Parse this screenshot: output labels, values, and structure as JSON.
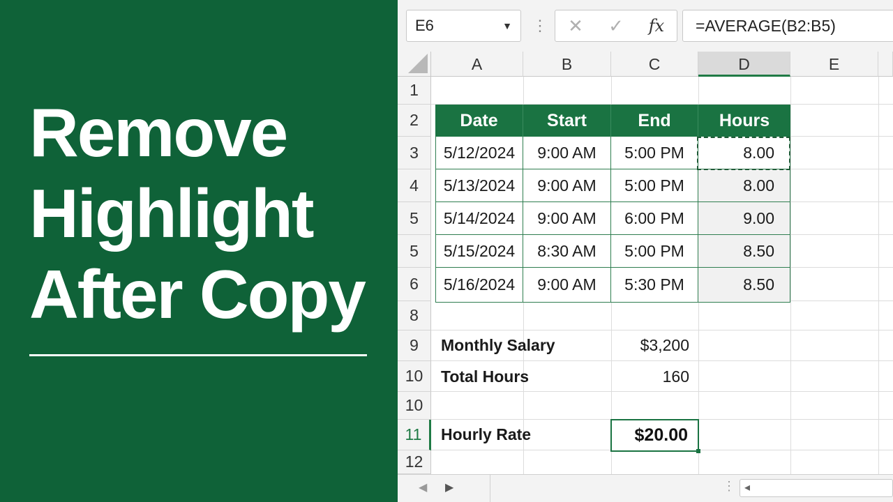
{
  "headline": {
    "lines": [
      "Remove",
      "Highlight",
      "After Copy"
    ]
  },
  "formula_bar": {
    "name_box": "E6",
    "cancel_glyph": "✕",
    "enter_glyph": "✓",
    "fx_glyph": "fx",
    "formula": "=AVERAGE(B2:B5)"
  },
  "columns": [
    "A",
    "B",
    "C",
    "D",
    "E"
  ],
  "selected_column": "D",
  "row_numbers": [
    "1",
    "2",
    "3",
    "4",
    "5",
    "5",
    "6",
    "8",
    "9",
    "10",
    "10",
    "11",
    "12"
  ],
  "active_row": "11",
  "table": {
    "headers": [
      "Date",
      "Start",
      "End",
      "Hours"
    ],
    "rows": [
      [
        "5/12/2024",
        "9:00 AM",
        "5:00 PM",
        "8.00"
      ],
      [
        "5/13/2024",
        "9:00 AM",
        "5:00 PM",
        "8.00"
      ],
      [
        "5/14/2024",
        "9:00 AM",
        "6:00 PM",
        "9.00"
      ],
      [
        "5/15/2024",
        "8:30 AM",
        "5:00 PM",
        "8.50"
      ],
      [
        "5/16/2024",
        "9:00 AM",
        "5:30 PM",
        "8.50"
      ]
    ]
  },
  "summary": {
    "salary_label": "Monthly Salary",
    "salary_value": "$3,200",
    "hours_label": "Total Hours",
    "hours_value": "160",
    "rate_label": "Hourly Rate",
    "rate_value": "$20.00"
  },
  "colors": {
    "panel_green": "#0f6238",
    "header_green": "#1a7342",
    "accent_green": "#1f7a45"
  }
}
